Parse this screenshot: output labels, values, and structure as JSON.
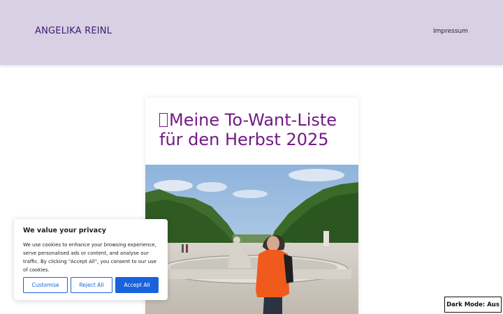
{
  "header": {
    "site_title": "ANGELIKA REINL",
    "nav": [
      {
        "label": "Impressum"
      }
    ]
  },
  "post": {
    "title": "Meine To-Want-Liste für den Herbst 2025",
    "photo_icon": "woman-in-orange-jacket-at-palace-garden-fountain-photo"
  },
  "cookie_banner": {
    "title": "We value your privacy",
    "text": "We use cookies to enhance your browsing experience, serve personalised ads or content, and analyse our traffic. By clicking \"Accept All\", you consent to our use of cookies.",
    "buttons": {
      "customise": "Customise",
      "reject": "Reject All",
      "accept": "Accept All"
    },
    "accent_color": "#1863dc"
  },
  "dark_mode_toggle": {
    "label": "Dark Mode: Aus"
  },
  "colors": {
    "header_bg": "#d9d0e3",
    "site_title": "#3d1b6e",
    "post_title": "#731a86"
  }
}
